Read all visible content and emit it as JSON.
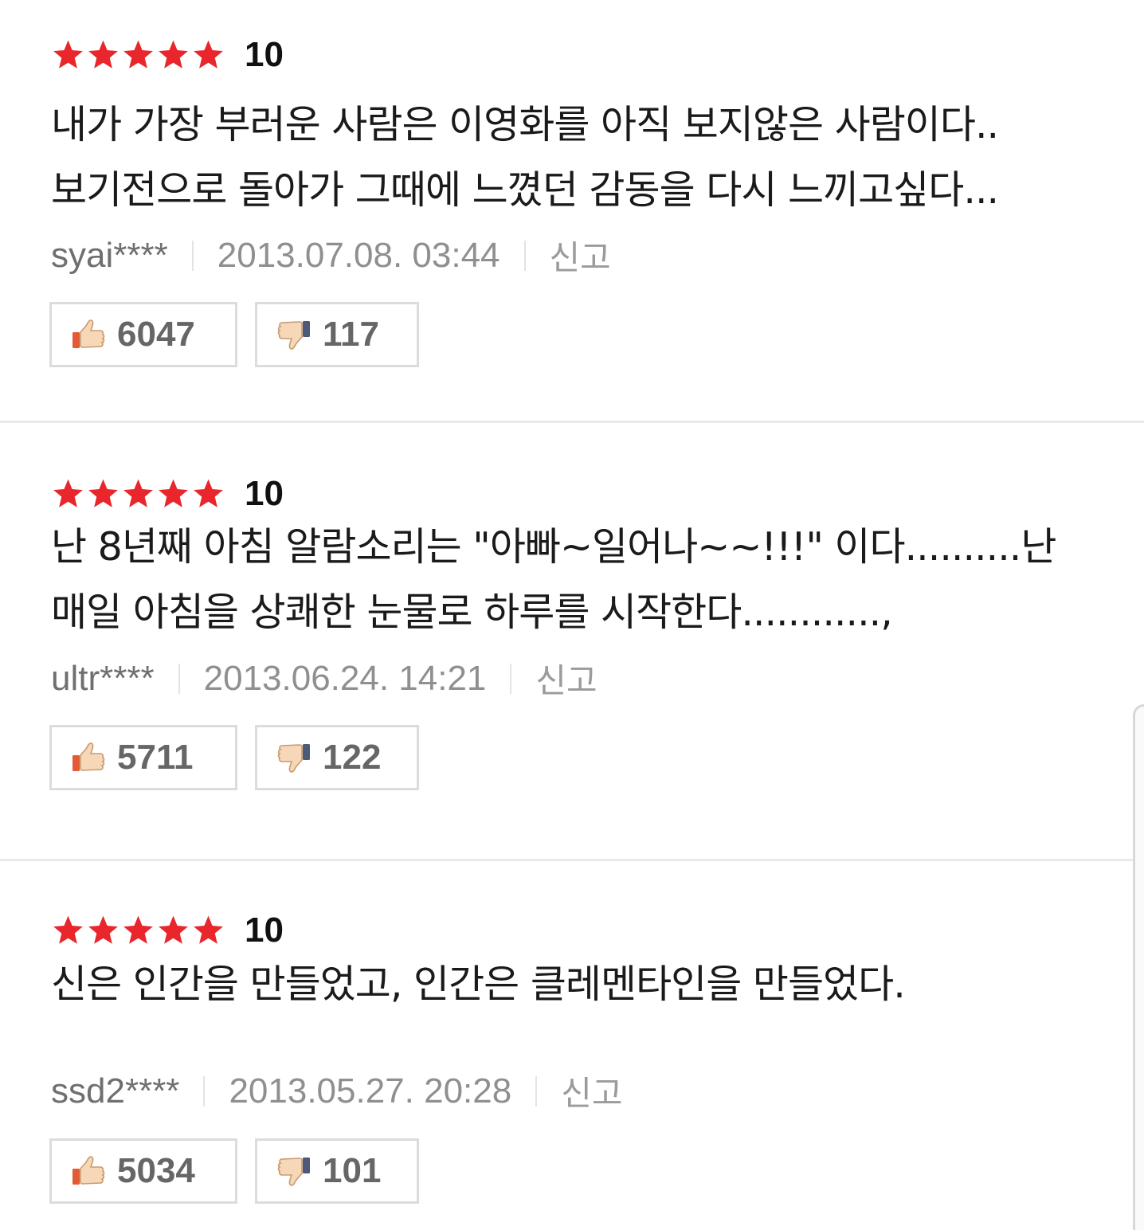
{
  "colors": {
    "star": "#e8262b",
    "divider": "#e9e9e9",
    "meta_text": "#8f8f8f"
  },
  "reviews": [
    {
      "stars_filled": 5,
      "score": "10",
      "comment": "내가 가장 부러운 사람은 이영화를 아직 보지않은 사람이다..\n보기전으로 돌아가 그때에 느꼈던 감동을 다시 느끼고싶다...",
      "user": "syai****",
      "date": "2013.07.08. 03:44",
      "report_label": "신고",
      "likes": "6047",
      "dislikes": "117"
    },
    {
      "stars_filled": 5,
      "score": "10",
      "comment": "난 8년째 아침 알람소리는 \"아빠~일어나~~!!!\" 이다..........난\n매일 아침을 상쾌한 눈물로 하루를 시작한다............,",
      "user": "ultr****",
      "date": "2013.06.24. 14:21",
      "report_label": "신고",
      "likes": "5711",
      "dislikes": "122"
    },
    {
      "stars_filled": 5,
      "score": "10",
      "comment": "신은 인간을 만들었고, 인간은 클레멘타인을 만들었다.",
      "user": "ssd2****",
      "date": "2013.05.27. 20:28",
      "report_label": "신고",
      "likes": "5034",
      "dislikes": "101"
    }
  ],
  "icons": {
    "star": "star-icon",
    "like": "thumbs-up-icon",
    "dislike": "thumbs-down-icon"
  }
}
